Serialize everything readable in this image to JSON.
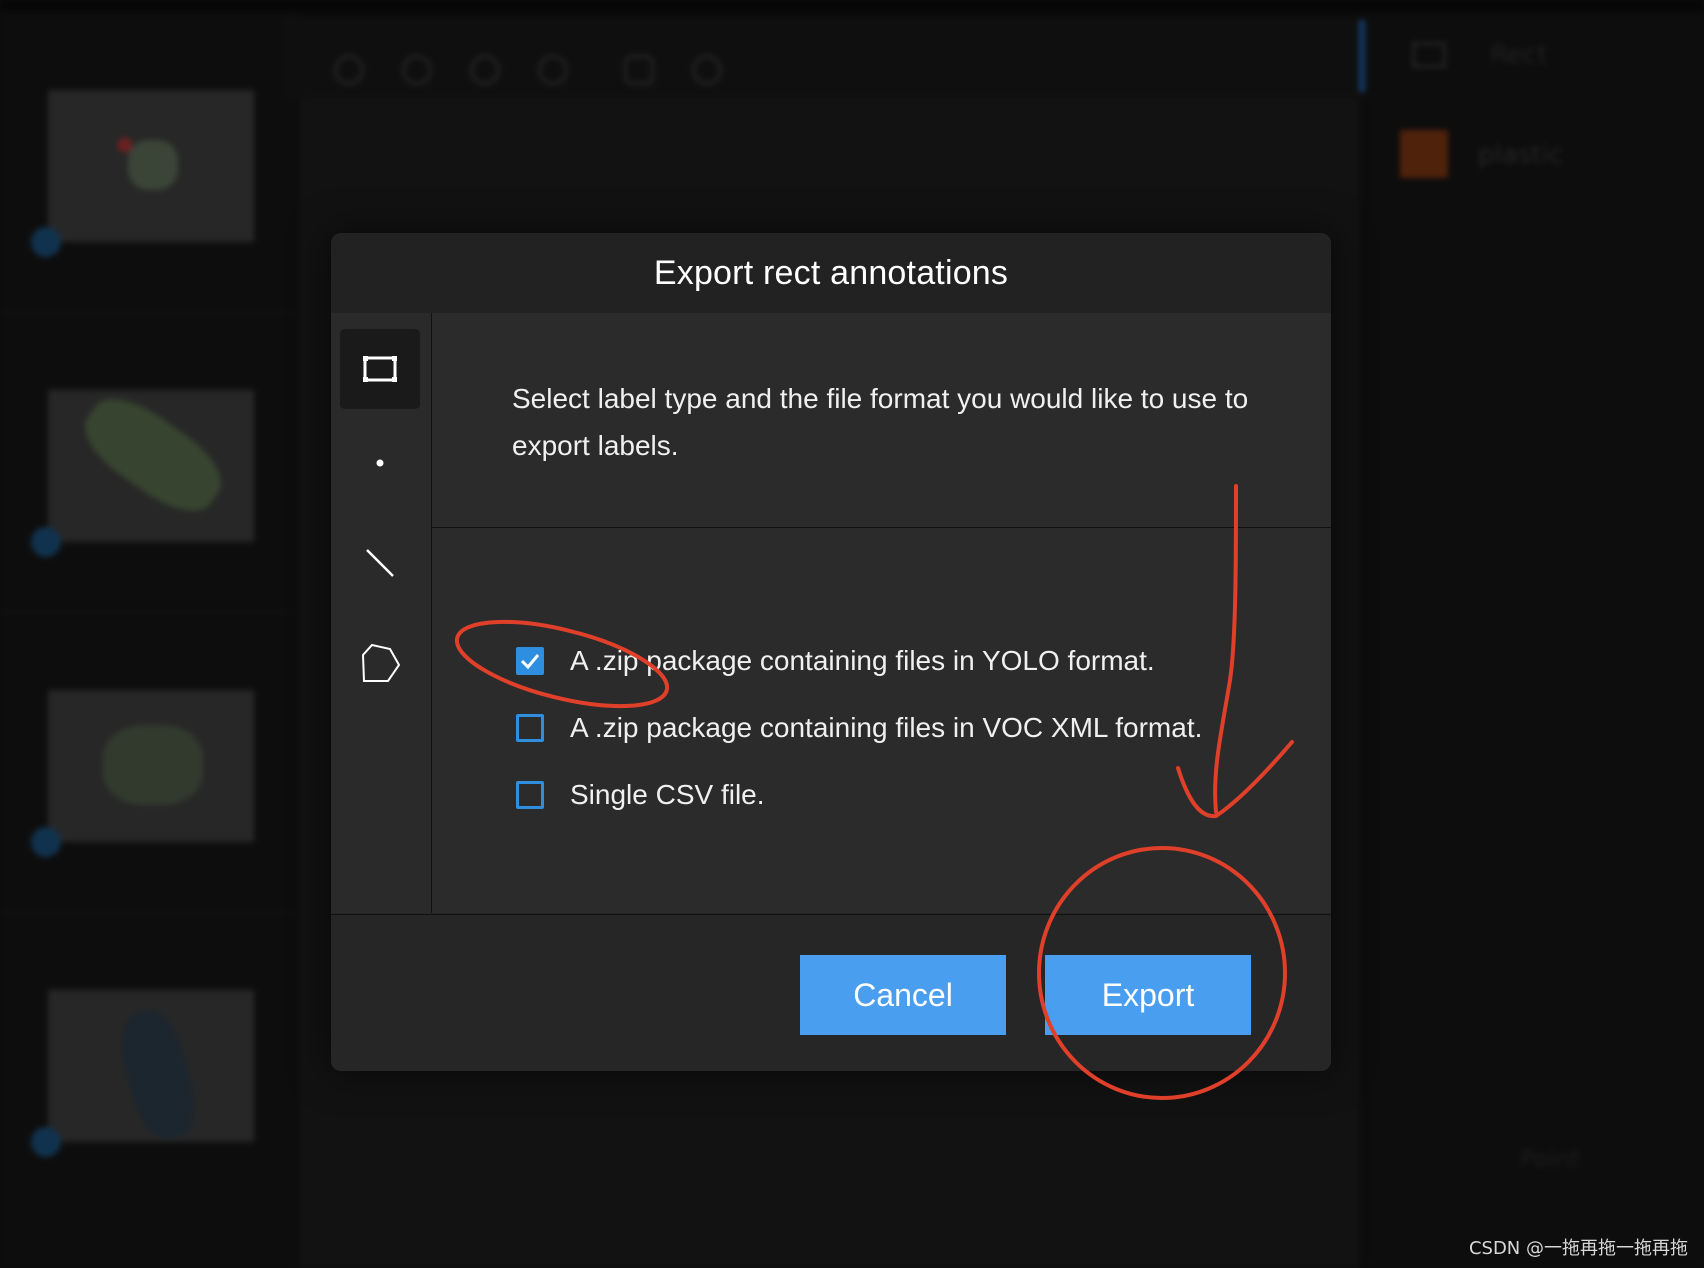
{
  "dialog": {
    "title": "Export rect annotations",
    "description": "Select label type and the file format you would like to use to export labels.",
    "label_types": [
      {
        "name": "rect-icon",
        "active": true
      },
      {
        "name": "point-icon",
        "active": false
      },
      {
        "name": "line-icon",
        "active": false
      },
      {
        "name": "polygon-icon",
        "active": false
      }
    ],
    "options": [
      {
        "label": "A .zip package containing files in YOLO format.",
        "checked": true
      },
      {
        "label": "A .zip package containing files in VOC XML format.",
        "checked": false
      },
      {
        "label": "Single CSV file.",
        "checked": false
      }
    ],
    "buttons": {
      "cancel": "Cancel",
      "export": "Export"
    }
  },
  "background": {
    "right_panel": {
      "tab_label": "Rect",
      "label_name": "plastic",
      "label_color": "#7a3512",
      "lower_item": "Point"
    }
  },
  "colors": {
    "accent": "#4a9ef0",
    "checkbox": "#2e8fe0",
    "annotation": "#e0402a"
  },
  "watermark": "CSDN @一拖再拖一拖再拖"
}
